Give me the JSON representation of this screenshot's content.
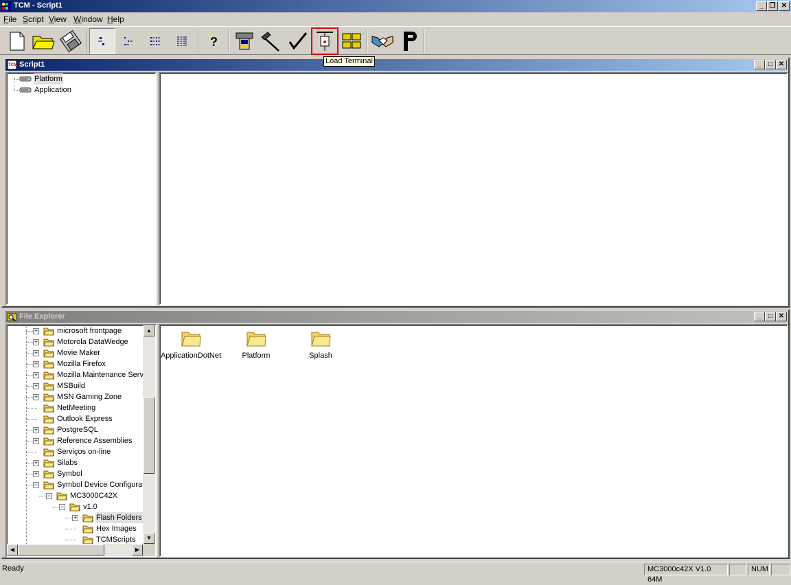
{
  "window": {
    "title": "TCM - Script1"
  },
  "menubar": {
    "items": [
      {
        "accel": "F",
        "rest": "ile"
      },
      {
        "accel": "S",
        "rest": "cript"
      },
      {
        "accel": "V",
        "rest": "iew"
      },
      {
        "accel": "W",
        "rest": "indow"
      },
      {
        "accel": "H",
        "rest": "elp"
      }
    ]
  },
  "toolbar": {
    "tooltip": "Load Terminal"
  },
  "script_window": {
    "title": "Script1",
    "tree": [
      "Platform",
      "Application"
    ]
  },
  "file_explorer": {
    "title": "File Explorer",
    "tree": [
      {
        "label": "microsoft frontpage"
      },
      {
        "label": "Motorola DataWedge"
      },
      {
        "label": "Movie Maker"
      },
      {
        "label": "Mozilla Firefox"
      },
      {
        "label": "Mozilla Maintenance Servi"
      },
      {
        "label": "MSBuild"
      },
      {
        "label": "MSN Gaming Zone"
      },
      {
        "label": "NetMeeting"
      },
      {
        "label": "Outlook Express"
      },
      {
        "label": "PostgreSQL"
      },
      {
        "label": "Reference Assemblies"
      },
      {
        "label": "Serviços on-line"
      },
      {
        "label": "Silabs"
      },
      {
        "label": "Symbol"
      },
      {
        "label": "Symbol Device Configurat"
      },
      {
        "label": "MC3000C42X"
      },
      {
        "label": "v1.0"
      },
      {
        "label": "Flash Folders"
      },
      {
        "label": "Hex Images"
      },
      {
        "label": "TCMScripts"
      }
    ],
    "files": [
      "ApplicationDotNet",
      "Platform",
      "Splash"
    ]
  },
  "statusbar": {
    "status": "Ready",
    "device": "MC3000c42X V1.0 64M",
    "num": "NUM"
  }
}
